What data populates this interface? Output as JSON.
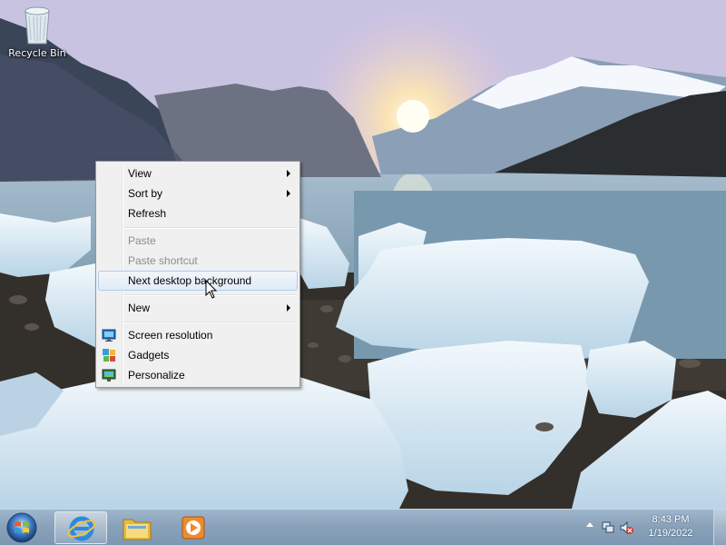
{
  "desktop": {
    "icons": [
      {
        "label": "Recycle Bin",
        "icon": "recycle-bin-icon"
      }
    ]
  },
  "context_menu": {
    "items": [
      {
        "label": "View",
        "submenu": true,
        "enabled": true
      },
      {
        "label": "Sort by",
        "submenu": true,
        "enabled": true
      },
      {
        "label": "Refresh",
        "enabled": true
      },
      {
        "label": "Paste",
        "enabled": false
      },
      {
        "label": "Paste shortcut",
        "enabled": false
      },
      {
        "label": "Next desktop background",
        "enabled": true,
        "highlighted": true
      },
      {
        "label": "New",
        "submenu": true,
        "enabled": true
      },
      {
        "label": "Screen resolution",
        "enabled": true,
        "icon": "screen-resolution-icon"
      },
      {
        "label": "Gadgets",
        "enabled": true,
        "icon": "gadgets-icon"
      },
      {
        "label": "Personalize",
        "enabled": true,
        "icon": "personalize-icon"
      }
    ]
  },
  "taskbar": {
    "pinned": [
      {
        "name": "Internet Explorer",
        "icon": "internet-explorer-icon",
        "active": true
      },
      {
        "name": "Windows Explorer",
        "icon": "folder-icon"
      },
      {
        "name": "Windows Media Player",
        "icon": "media-player-icon"
      }
    ],
    "clock": {
      "time": "8:43 PM",
      "date": "1/19/2022"
    }
  },
  "colors": {
    "menu_bg": "#f0f0f0",
    "menu_highlight_border": "#aeccf0",
    "taskbar": "#8aa3bb"
  }
}
